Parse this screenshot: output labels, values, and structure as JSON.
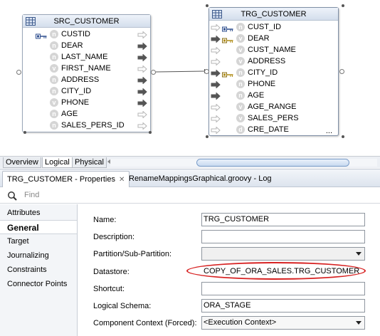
{
  "source": {
    "title": "SRC_CUSTOMER",
    "attributes": [
      {
        "name": "CUSTID",
        "type": "n",
        "key": true,
        "out": "hollow"
      },
      {
        "name": "DEAR",
        "type": "n",
        "key": false,
        "out": "filled"
      },
      {
        "name": "LAST_NAME",
        "type": "n",
        "key": false,
        "out": "filled"
      },
      {
        "name": "FIRST_NAME",
        "type": "v",
        "key": false,
        "out": "hollow"
      },
      {
        "name": "ADDRESS",
        "type": "n",
        "key": false,
        "out": "filled"
      },
      {
        "name": "CITY_ID",
        "type": "n",
        "key": false,
        "out": "filled"
      },
      {
        "name": "PHONE",
        "type": "v",
        "key": false,
        "out": "filled"
      },
      {
        "name": "AGE",
        "type": "n",
        "key": false,
        "out": "hollow"
      },
      {
        "name": "SALES_PERS_ID",
        "type": "n",
        "key": false,
        "out": "hollow"
      }
    ]
  },
  "target": {
    "title": "TRG_CUSTOMER",
    "more": "...",
    "attributes": [
      {
        "name": "CUST_ID",
        "type": "n",
        "key": true,
        "in": "hollow"
      },
      {
        "name": "DEAR",
        "type": "v",
        "key": true,
        "in": "filled"
      },
      {
        "name": "CUST_NAME",
        "type": "v",
        "key": false,
        "in": "hollow"
      },
      {
        "name": "ADDRESS",
        "type": "v",
        "key": false,
        "in": "hollow"
      },
      {
        "name": "CITY_ID",
        "type": "n",
        "key": true,
        "in": "filled"
      },
      {
        "name": "PHONE",
        "type": "n",
        "key": false,
        "in": "filled"
      },
      {
        "name": "AGE",
        "type": "n",
        "key": false,
        "in": "filled"
      },
      {
        "name": "AGE_RANGE",
        "type": "v",
        "key": false,
        "in": "hollow"
      },
      {
        "name": "SALES_PERS",
        "type": "v",
        "key": false,
        "in": "hollow"
      },
      {
        "name": "CRE_DATE",
        "type": "d",
        "key": false,
        "in": "hollow"
      }
    ]
  },
  "editor_tabs": [
    "Overview",
    "Logical",
    "Physical"
  ],
  "panel_tabs": {
    "properties": "TRG_CUSTOMER - Properties",
    "log": "RenameMappingsGraphical.groovy - Log"
  },
  "find_placeholder": "Find",
  "nav_items": [
    "Attributes",
    "General",
    "Target",
    "Journalizing",
    "Constraints",
    "Connector Points"
  ],
  "form": {
    "name_label": "Name:",
    "name_value": "TRG_CUSTOMER",
    "description_label": "Description:",
    "description_value": "",
    "partition_label": "Partition/Sub-Partition:",
    "partition_value": "",
    "datastore_label": "Datastore:",
    "datastore_value": "COPY_OF_ORA_SALES.TRG_CUSTOMER",
    "shortcut_label": "Shortcut:",
    "shortcut_value": "",
    "schema_label": "Logical Schema:",
    "schema_value": "ORA_STAGE",
    "context_label": "Component Context (Forced):",
    "context_value": "<Execution Context>"
  },
  "colors": {
    "highlight_oval": "#d72222",
    "scroll_thumb": "#7a9cc8",
    "type_circle": "#d5d5d5"
  }
}
